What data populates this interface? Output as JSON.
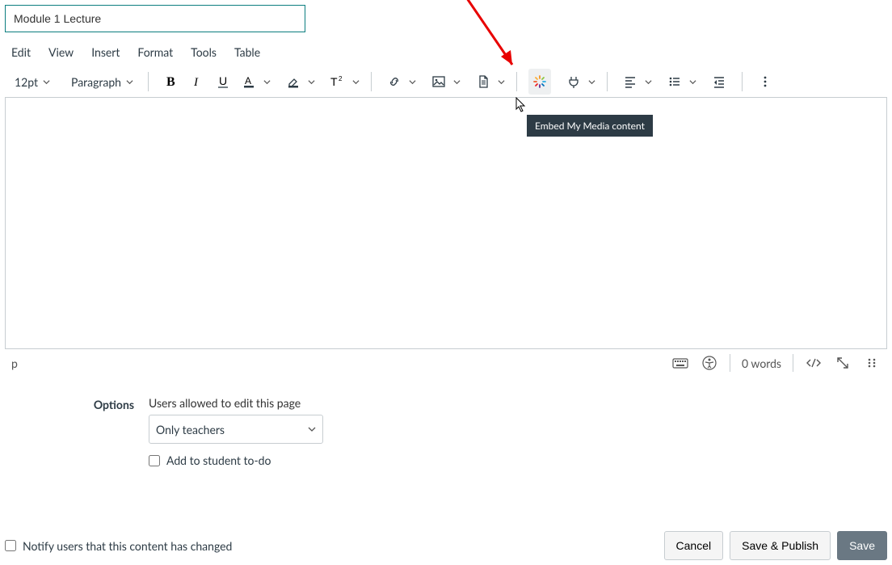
{
  "title": "Module 1 Lecture",
  "menu": {
    "edit": "Edit",
    "view": "View",
    "insert": "Insert",
    "format": "Format",
    "tools": "Tools",
    "table": "Table"
  },
  "toolbar": {
    "fontSize": "12pt",
    "blockType": "Paragraph"
  },
  "tooltip": "Embed My Media content",
  "status": {
    "path": "p",
    "wordcount": "0 words"
  },
  "options": {
    "heading": "Options",
    "desc": "Users allowed to edit this page",
    "selectValue": "Only teachers",
    "addTodo": "Add to student to-do"
  },
  "footer": {
    "notify": "Notify users that this content has changed",
    "cancel": "Cancel",
    "savePublish": "Save & Publish",
    "save": "Save"
  }
}
